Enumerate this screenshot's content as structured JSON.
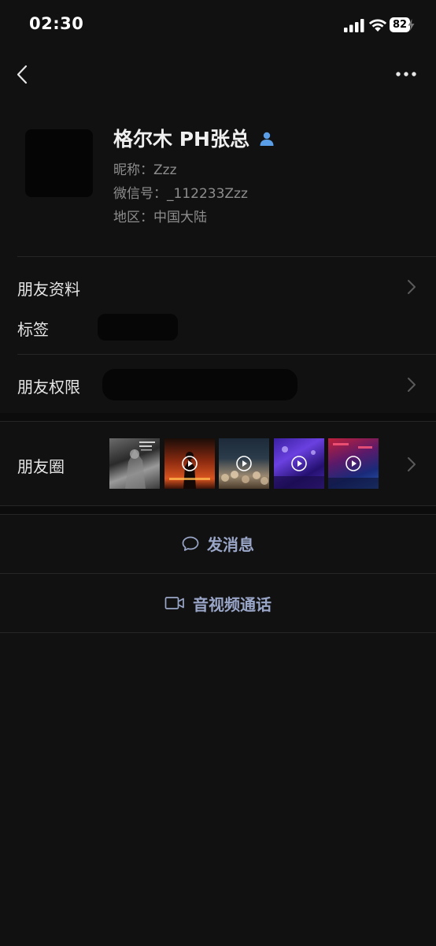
{
  "status_bar": {
    "time": "02:30",
    "battery_level": "82"
  },
  "profile": {
    "name": "格尔木  PH张总",
    "nickname": "昵称：Zzz",
    "wechat_id": "微信号：_112233Zzz",
    "region": "地区：中国大陆"
  },
  "rows": {
    "friend_info": "朋友资料",
    "tags": "标签",
    "permissions": "朋友权限",
    "moments": "朋友圈"
  },
  "actions": {
    "send_message": "发消息",
    "av_call": "音视频通话"
  },
  "colors": {
    "background": "#111111",
    "accent_action": "#9aa6c8",
    "contact_icon": "#5b9ee8"
  }
}
